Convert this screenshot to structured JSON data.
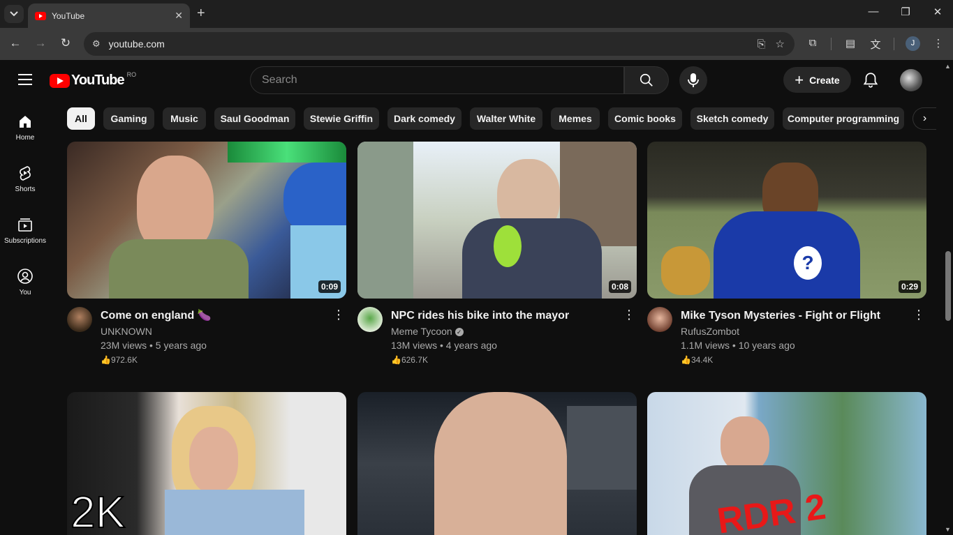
{
  "browser": {
    "tab_title": "YouTube",
    "url": "youtube.com",
    "profile_initial": "J"
  },
  "header": {
    "logo_text": "YouTube",
    "region": "RO",
    "search_placeholder": "Search",
    "create_label": "Create"
  },
  "sidebar": {
    "items": [
      {
        "label": "Home",
        "icon": "home-icon"
      },
      {
        "label": "Shorts",
        "icon": "shorts-icon"
      },
      {
        "label": "Subscriptions",
        "icon": "subscriptions-icon"
      },
      {
        "label": "You",
        "icon": "you-icon"
      }
    ]
  },
  "chips": [
    "All",
    "Gaming",
    "Music",
    "Saul Goodman",
    "Stewie Griffin",
    "Dark comedy",
    "Walter White",
    "Memes",
    "Comic books",
    "Sketch comedy",
    "Computer programming"
  ],
  "videos": [
    {
      "title": "Come on england 🍆",
      "channel": "UNKNOWN",
      "stats": "23M views • 5 years ago",
      "likes": "972.6K",
      "duration": "0:09",
      "verified": false
    },
    {
      "title": "NPC rides his bike into the mayor",
      "channel": "Meme Tycoon",
      "stats": "13M views • 4 years ago",
      "likes": "626.7K",
      "duration": "0:08",
      "verified": true
    },
    {
      "title": "Mike Tyson Mysteries - Fight or Flight",
      "channel": "RufusZombot",
      "stats": "1.1M views • 10 years ago",
      "likes": "34.4K",
      "duration": "0:29",
      "verified": false
    },
    {
      "title": "",
      "channel": "",
      "stats": "",
      "likes": "",
      "duration": "",
      "thumb_text": "2K",
      "verified": false
    },
    {
      "title": "",
      "channel": "",
      "stats": "",
      "likes": "",
      "duration": "",
      "verified": false
    },
    {
      "title": "",
      "channel": "",
      "stats": "",
      "likes": "",
      "duration": "",
      "thumb_text": "RDR 2",
      "verified": false
    }
  ]
}
